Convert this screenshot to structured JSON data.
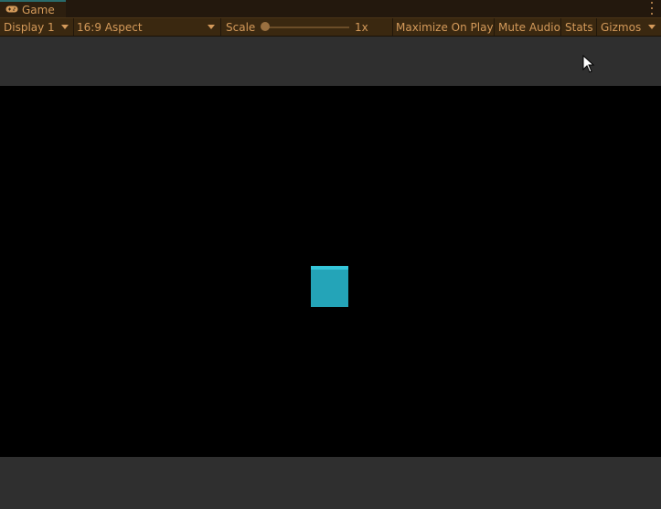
{
  "window": {
    "tab_title": "Game",
    "tab_icon": "gamepad-icon",
    "menu_icon": "kebab-menu-icon"
  },
  "toolbar": {
    "display": "Display 1",
    "aspect": "16:9 Aspect",
    "scale_label": "Scale",
    "scale_value": "1x",
    "scale_level": 0,
    "maximize": "Maximize On Play",
    "mute": "Mute Audio",
    "stats": "Stats",
    "gizmos": "Gizmos"
  },
  "scene": {
    "cube_color": "#24a4b8",
    "cube_top_color": "#35c6da",
    "background": "#000000"
  },
  "colors": {
    "accent_text": "#d49a5a",
    "toolbar_bg": "#3a2810"
  }
}
